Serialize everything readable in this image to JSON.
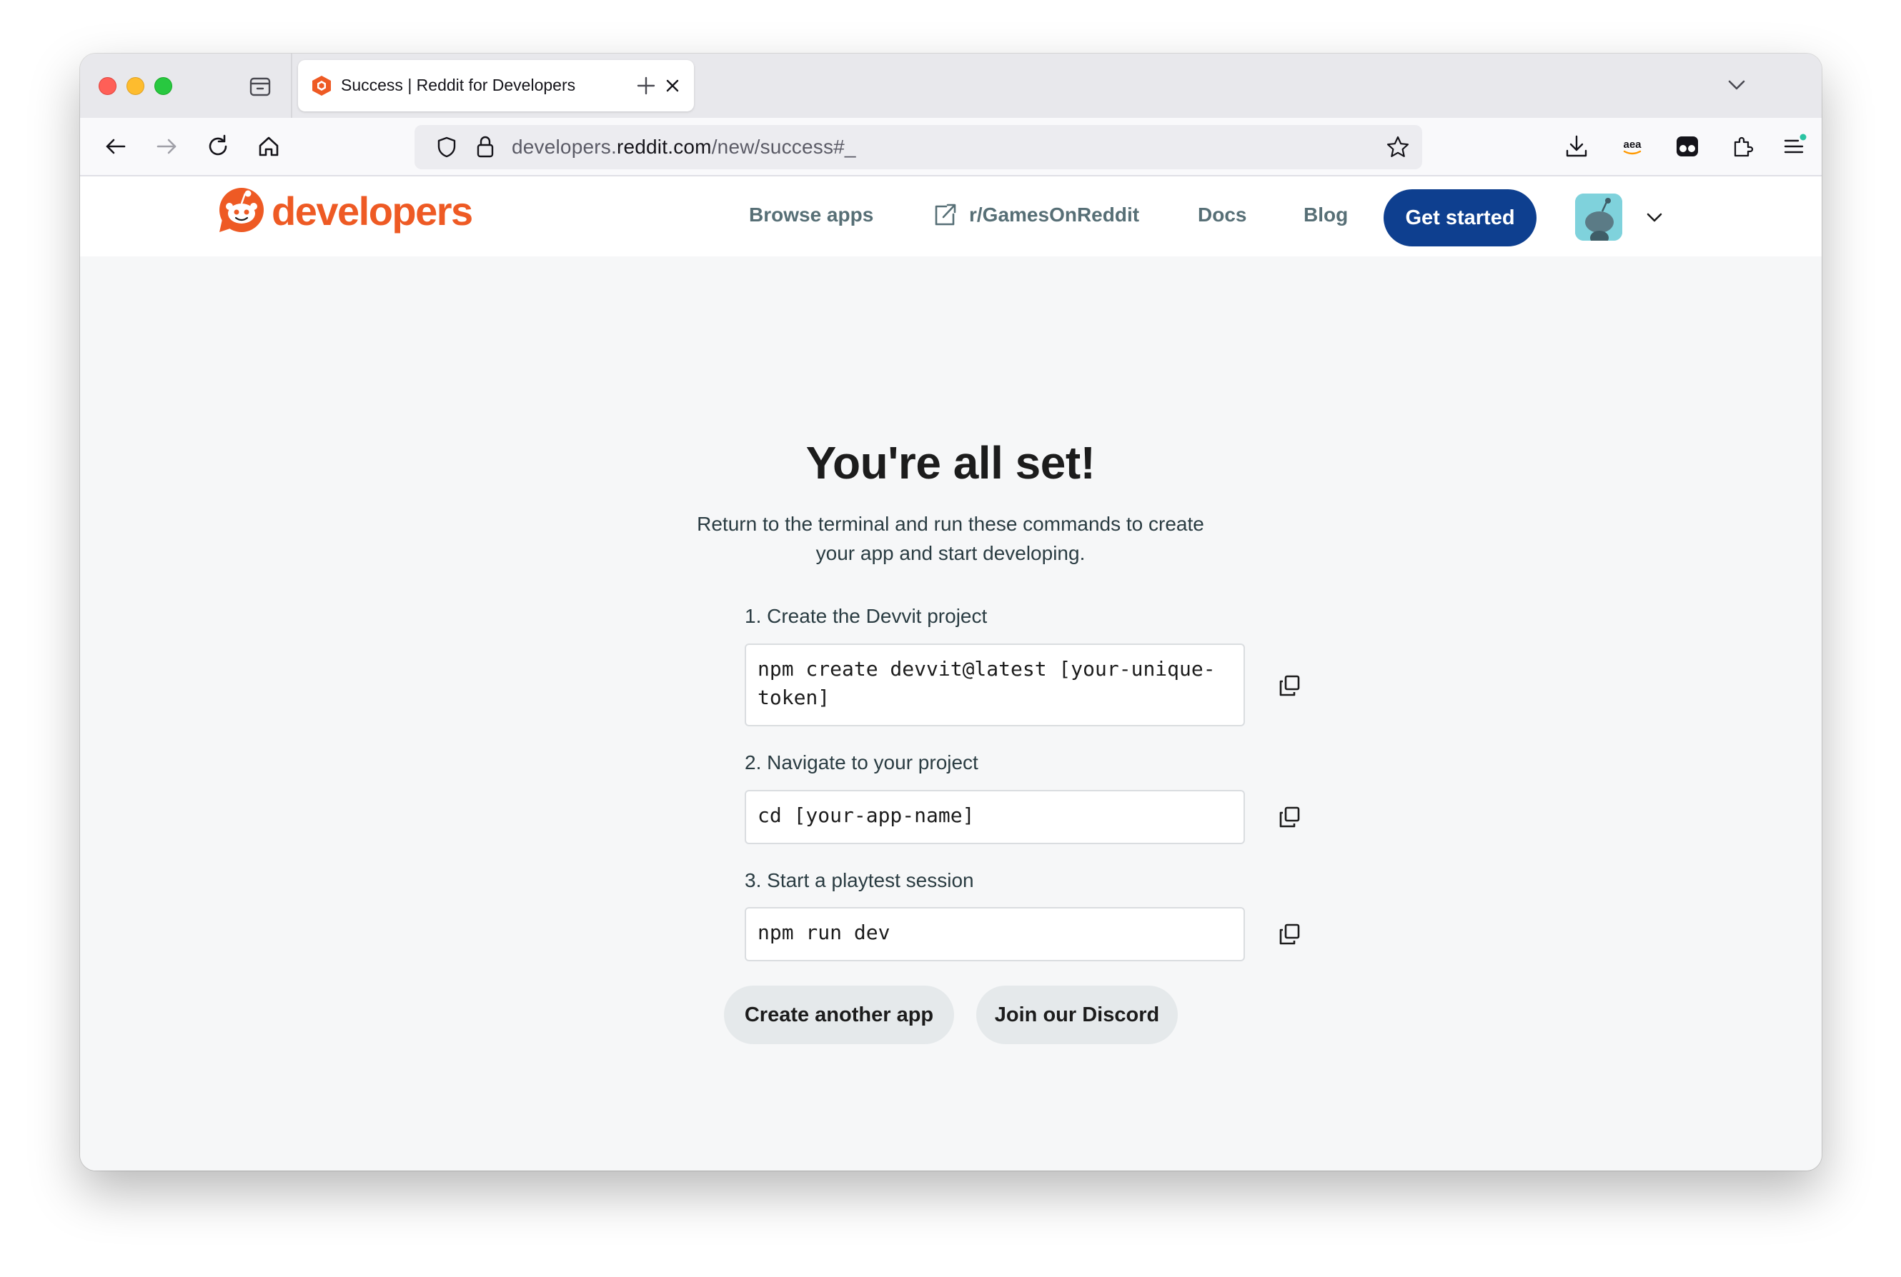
{
  "browser": {
    "tab_title": "Success | Reddit for Developers",
    "url_host_prefix": "developers.",
    "url_host": "reddit.com",
    "url_path": "/new/success#_"
  },
  "header": {
    "logo_text": "developers",
    "nav": {
      "browse_apps": "Browse apps",
      "subreddit": "r/GamesOnReddit",
      "docs": "Docs",
      "blog": "Blog"
    },
    "get_started": "Get started"
  },
  "main": {
    "title": "You're all set!",
    "subtitle_line1": "Return to the terminal and run these commands to create",
    "subtitle_line2": "your app and start developing.",
    "steps": [
      {
        "label": "1. Create the Devvit project",
        "command": "npm create devvit@latest [your-unique-\ntoken]"
      },
      {
        "label": "2. Navigate to your project",
        "command": "cd [your-app-name]"
      },
      {
        "label": "3. Start a playtest session",
        "command": "npm run dev"
      }
    ],
    "actions": {
      "create_another": "Create another app",
      "join_discord": "Join our Discord"
    }
  },
  "colors": {
    "brand_orange": "#ee5a24",
    "primary_button": "#0e3f8f",
    "page_background": "#f6f7f8"
  }
}
